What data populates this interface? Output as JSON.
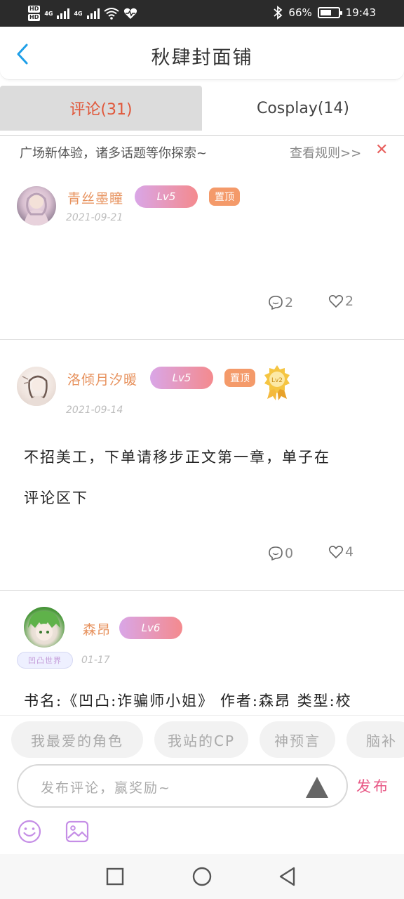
{
  "status_bar": {
    "hd1": "HD",
    "hd2": "HD",
    "net1": "4G",
    "net2": "4G",
    "battery_percent": "66%",
    "battery_level": 0.66,
    "time": "19:43",
    "icons": [
      "wifi-icon",
      "heart-monitor-icon",
      "bluetooth-icon",
      "battery-icon"
    ]
  },
  "header": {
    "title": "秋肆封面铺",
    "back_icon": "chevron-left-icon",
    "accent": "#1e9fe8"
  },
  "tabs": [
    {
      "label": "评论(31)",
      "active": true
    },
    {
      "label": "Cosplay(14)",
      "active": false
    }
  ],
  "notice": {
    "text": "广场新体验，诸多话题等你探索~",
    "rule_link": "查看规则>>",
    "close_icon": "close-icon"
  },
  "posts": [
    {
      "username": "青丝墨瞳",
      "level": "Lv5",
      "pinned": "置顶",
      "date": "2021-09-21",
      "content": "",
      "comments": "2",
      "likes": "2"
    },
    {
      "username": "洛倾月汐暖",
      "level": "Lv5",
      "pinned": "置顶",
      "medal": "Lv2",
      "date": "2021-09-14",
      "content_line1": "不招美工，下单请移步正文第一章，单子在",
      "content_line2": "评论区下",
      "comments": "0",
      "likes": "4"
    },
    {
      "username": "森昂",
      "level": "Lv6",
      "badge": "凹凸世界",
      "date": "01-17",
      "content_line1": "书名:《凹凸:诈骗师小姐》 作者:森昂  类型:校"
    }
  ],
  "topics": [
    "我最爱的角色",
    "我站的CP",
    "神预言",
    "脑补"
  ],
  "composer": {
    "placeholder": "发布评论，赢奖励~",
    "publish_label": "发布"
  },
  "toolbar_icons": [
    "emoji-icon",
    "image-icon"
  ],
  "navbar_icons": [
    "recent-apps-icon",
    "home-icon",
    "back-icon"
  ],
  "colors": {
    "username": "#e7925e",
    "active_tab": "#e0573a",
    "publish": "#e85a87",
    "pin": "#f49a6a"
  }
}
